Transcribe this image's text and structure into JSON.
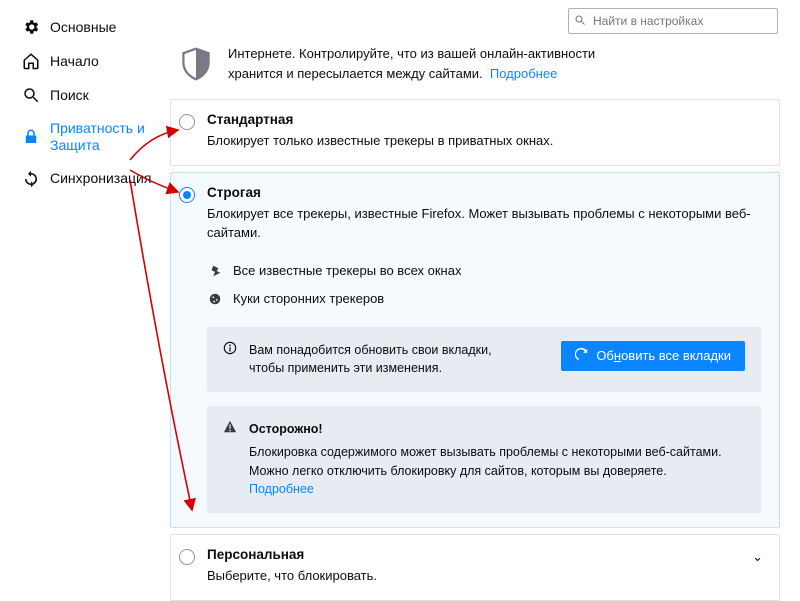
{
  "search": {
    "placeholder": "Найти в настройках"
  },
  "sidebar": {
    "items": [
      {
        "label": "Основные"
      },
      {
        "label": "Начало"
      },
      {
        "label": "Поиск"
      },
      {
        "label": "Приватность и Защита"
      },
      {
        "label": "Синхронизация"
      }
    ]
  },
  "intro": {
    "text_line1": "Интернете. Контролируйте, что из вашей онлайн-активности",
    "text_line2": "хранится и пересылается между сайтами.",
    "more": "Подробнее"
  },
  "options": {
    "standard": {
      "title": "Стандартная",
      "desc": "Блокирует только известные трекеры в приватных окнах."
    },
    "strict": {
      "title": "Строгая",
      "desc": "Блокирует все трекеры, известные Firefox. Может вызывать проблемы с некоторыми веб-сайтами.",
      "list": {
        "trackers": "Все известные трекеры во всех окнах",
        "cookies": "Куки сторонних трекеров"
      },
      "info": {
        "text1": "Вам понадобится обновить свои вкладки,",
        "text2": "чтобы применить эти изменения.",
        "button_prefix": "Об",
        "button_u": "н",
        "button_suffix": "овить все вкладки"
      },
      "warn": {
        "title": "Осторожно!",
        "text": "Блокировка содержимого может вызывать проблемы с некоторыми веб-сайтами. Можно легко отключить блокировку для сайтов, которым вы доверяете.",
        "more": "Подробнее"
      }
    },
    "custom": {
      "title": "Персональная",
      "desc": "Выберите, что блокировать."
    }
  }
}
